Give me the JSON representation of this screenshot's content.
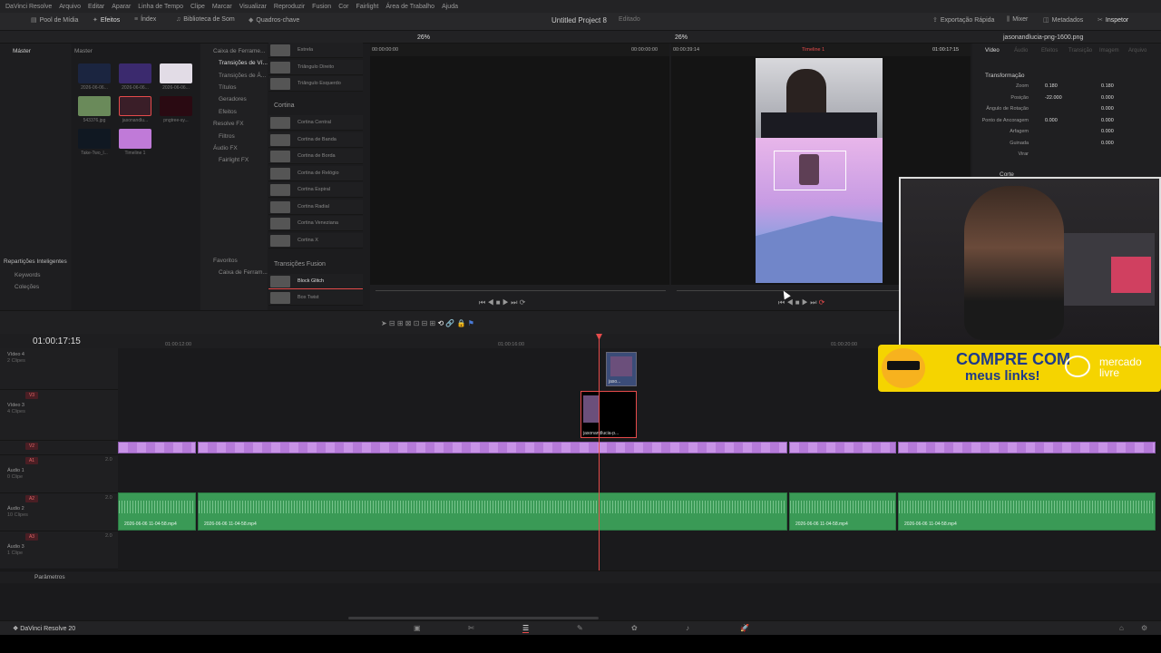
{
  "menu": [
    "DaVinci Resolve",
    "Arquivo",
    "Editar",
    "Aparar",
    "Linha de Tempo",
    "Clipe",
    "Marcar",
    "Visualizar",
    "Reproduzir",
    "Fusion",
    "Cor",
    "Fairlight",
    "Área de Trabalho",
    "Ajuda"
  ],
  "topbar": {
    "media_pool": "Pool de Mídia",
    "effects": "Efeitos",
    "index": "Índex",
    "sound_library": "Biblioteca de Som",
    "keyframes": "Quadros-chave",
    "project_title": "Untitled Project 8",
    "edited": "Editado",
    "quick_export": "Exportação Rápida",
    "mixer": "Mixer",
    "metadata": "Metadados",
    "inspector": "Inspetor"
  },
  "row2": {
    "zoom_left": "26%",
    "zoom_right": "26%",
    "timecode_left": "00:00:00:00",
    "timecode_mid": "00:00:00:00",
    "timecode_right": "00:00:39:14",
    "timeline_name": "Timeline 1",
    "timecode_end": "01:00:17:15",
    "file_name": "jasonandlucia-png-1600.png"
  },
  "media": {
    "master_label": "Master",
    "sidebar_master": "Máster",
    "smart_bins": "Repartições Inteligentes",
    "keywords": "Keywords",
    "collections": "Coleções",
    "items": [
      "2026-06-06...",
      "2026-06-06...",
      "2026-06-06...",
      "543376.jpg",
      "jasonandlu...",
      "pngtree-sy...",
      "Take-Two_l...",
      "Timeline 1"
    ]
  },
  "effects_tree": {
    "toolbox": "Caixa de Ferrame...",
    "video_transitions": "Transições de Ví...",
    "audio_transitions": "Transições de Á...",
    "titles": "Títulos",
    "generators": "Geradores",
    "effects": "Efeitos",
    "resolve_fx": "Resolve FX",
    "filters": "Filtros",
    "audio_fx": "Áudio FX",
    "fairlight_fx": "Fairlight FX",
    "favorites": "Favoritos",
    "fav_toolbox": "Caixa de Ferram..."
  },
  "effects_list": {
    "top": [
      "Estrela",
      "Triângulo Direito",
      "Triângulo Esquerdo"
    ],
    "cortina_title": "Cortina",
    "cortina": [
      "Cortina Central",
      "Cortina de Banda",
      "Cortina de Borda",
      "Cortina de Relógio",
      "Cortina Espiral",
      "Cortina Radial",
      "Cortina Veneziana",
      "Cortina X"
    ],
    "fusion_title": "Transições Fusion",
    "fusion": [
      "Block Glitch",
      "Box Twist"
    ]
  },
  "inspector": {
    "tab_video": "Vídeo",
    "tab_audio": "Áudio",
    "tab_effects": "Efeitos",
    "tab_transition": "Transição",
    "tab_image": "Imagem",
    "tab_file": "Arquivo",
    "transform": "Transformação",
    "zoom": "Zoom",
    "zoom_x": "0.180",
    "zoom_y": "0.180",
    "position": "Posição",
    "pos_x": "-22.000",
    "pos_y": "0.000",
    "rotation": "Ângulo de Rotação",
    "rotation_val": "0.000",
    "anchor": "Ponto de Ancoragem",
    "anchor_x": "0.000",
    "anchor_y": "0.000",
    "pitch": "Arfagem",
    "pitch_val": "0.000",
    "yaw": "Guinada",
    "yaw_val": "0.000",
    "flip": "Virar",
    "crop": "Corte"
  },
  "timeline": {
    "timecode": "01:00:17:15",
    "ruler": [
      "01:00:12:00",
      "01:00:16:00",
      "01:00:20:00"
    ],
    "tracks": [
      {
        "name": "Vídeo 4",
        "clips": "2 Clipes"
      },
      {
        "badge": "V3",
        "name": "Vídeo 3",
        "clips": "4 Clipes"
      },
      {
        "badge": "V2",
        "name": "Vídeo 2",
        "clips": ""
      },
      {
        "badge": "A1",
        "name": "Áudio 1",
        "clips": "0 Clipe",
        "vol": "2.0"
      },
      {
        "badge": "A2",
        "name": "Áudio 2",
        "clips": "10 Clipes",
        "vol": "2.0"
      },
      {
        "badge": "A3",
        "name": "Áudio 3",
        "clips": "1 Clipe",
        "vol": "2.0"
      }
    ],
    "v4_clip": "jaso...",
    "v3_clip": "jasonandlucia-p...",
    "audio_clips": [
      "2026-06-06 11-04-58.mp4",
      "2026-06-06 11-04-58.mp4",
      "2026-06-06 11-04-58.mp4",
      "2026-06-06 11-04-58.mp4"
    ],
    "params": "Parâmetros"
  },
  "bottom": {
    "app": "DaVinci Resolve 20"
  },
  "promo": {
    "line1": "COMPRE COM",
    "line2": "meus links!",
    "brand1": "mercado",
    "brand2": "livre"
  },
  "colors": {
    "accent": "#e64b4b",
    "audio": "#3a9a56",
    "video": "#c893e6"
  }
}
